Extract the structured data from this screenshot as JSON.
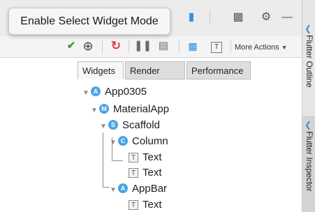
{
  "tooltip": {
    "text": "Enable Select Widget Mode"
  },
  "toolbar": {
    "more_actions_label": "More Actions",
    "checkmark_icon": "check-icon",
    "select_widget_icon": "crosshair-icon",
    "refresh_icon": "refresh-icon",
    "performance_icon": "bars-icon",
    "repaint_icon": "window-icon",
    "debug_paint_icon": "grid-icon",
    "text_icon": "text-icon"
  },
  "tabs": [
    {
      "label": "Widgets",
      "active": true
    },
    {
      "label": "Render Tree",
      "active": false
    },
    {
      "label": "Performance",
      "active": false
    }
  ],
  "tree": [
    {
      "badge": "A",
      "label": "App0305"
    },
    {
      "badge": "M",
      "label": "MaterialApp"
    },
    {
      "badge": "S",
      "label": "Scaffold"
    },
    {
      "badge": "C",
      "label": "Column"
    },
    {
      "badge": "T",
      "label": "Text"
    },
    {
      "badge": "T",
      "label": "Text"
    },
    {
      "badge": "A",
      "label": "AppBar"
    },
    {
      "badge": "T",
      "label": "Text"
    }
  ],
  "side_panel": {
    "outline_label": "Flutter Outline",
    "inspector_label": "Flutter Inspector"
  },
  "colors": {
    "accent_blue": "#4ca3e6",
    "refresh_red": "#e0403a",
    "check_green": "#3a9d3a"
  }
}
